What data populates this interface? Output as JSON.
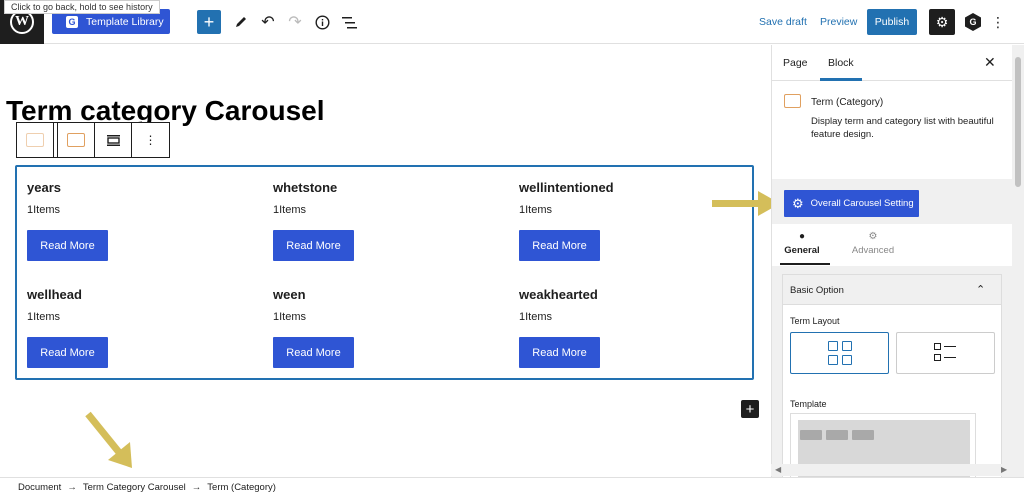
{
  "topbar": {
    "tooltip": "Click to go back, hold to see history",
    "wp_logo": "W",
    "template_library": "Template Library",
    "g_badge": "G",
    "save_draft": "Save draft",
    "preview": "Preview",
    "publish": "Publish"
  },
  "editor": {
    "title": "Term category Carousel",
    "items": [
      {
        "name": "years",
        "count": "1Items",
        "button": "Read More"
      },
      {
        "name": "whetstone",
        "count": "1Items",
        "button": "Read More"
      },
      {
        "name": "wellintentioned",
        "count": "1Items",
        "button": "Read More"
      },
      {
        "name": "wellhead",
        "count": "1Items",
        "button": "Read More"
      },
      {
        "name": "ween",
        "count": "1Items",
        "button": "Read More"
      },
      {
        "name": "weakhearted",
        "count": "1Items",
        "button": "Read More"
      }
    ]
  },
  "breadcrumb": {
    "items": [
      "Document",
      "Term Category Carousel",
      "Term (Category)"
    ],
    "separator": "→"
  },
  "sidebar": {
    "tab_page": "Page",
    "tab_block": "Block",
    "block_title": "Term (Category)",
    "block_desc": "Display term and category list with beautiful feature design.",
    "overall_setting": "Overall Carousel Setting",
    "tab_general": "General",
    "tab_advanced": "Advanced",
    "basic_option": "Basic Option",
    "term_layout": "Term Layout",
    "template": "Template"
  },
  "colors": {
    "primary_blue": "#2f55d4",
    "wp_blue": "#2271b1",
    "annotation_arrow": "#d4be5a"
  }
}
